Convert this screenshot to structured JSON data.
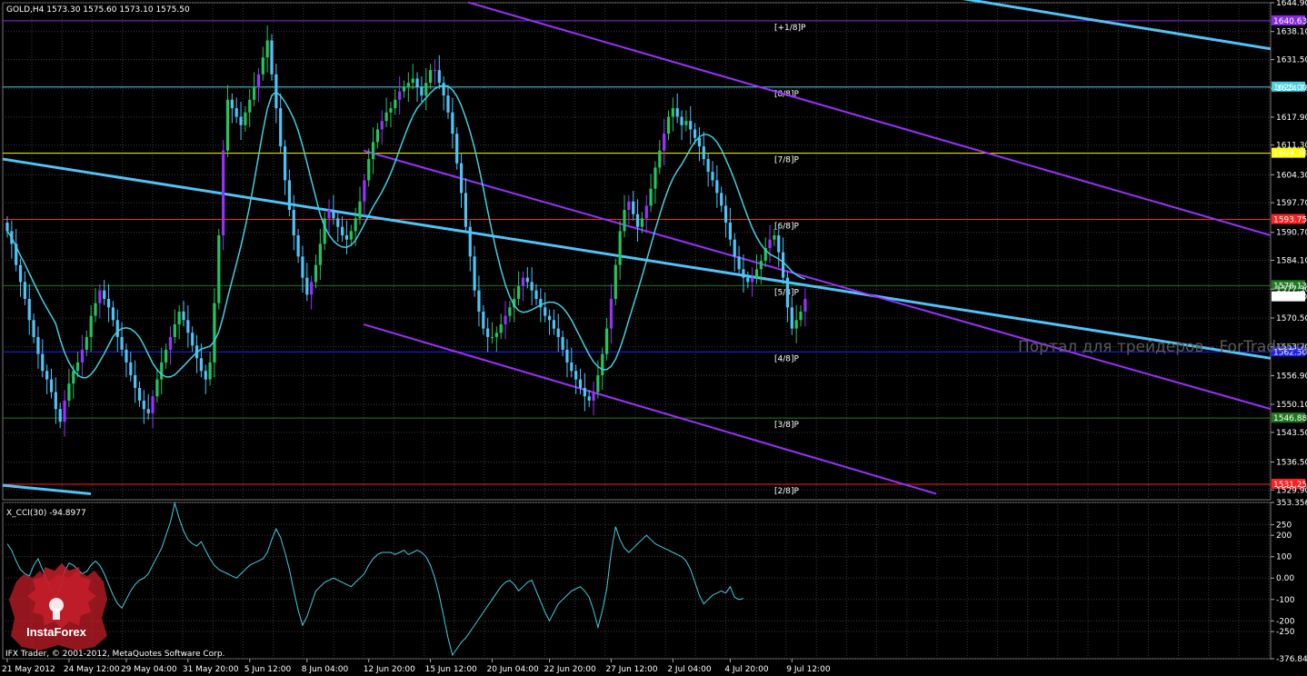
{
  "header": {
    "symbol_title": "GOLD,H4 1573.30 1575.60 1573.10 1575.50"
  },
  "indicator": {
    "title": "X_CCI(30) -94.8977"
  },
  "watermark": {
    "site": "Портал для трейдеров - ForTrader.ru",
    "brand": "InstaForex",
    "copyright": "IFX Trader, © 2001-2012, MetaQuotes Software Corp."
  },
  "colors": {
    "background": "#000000",
    "grid": "#3a3a3a",
    "bull_candle": "#22c55e",
    "bear_candle": "#4fc3f7",
    "purple_candle": "#9b30ff",
    "ma_line": "#40d0e0",
    "trend_line": "#4fc3f7",
    "channel_line": "#9b30ff",
    "cci_line": "#40d0e0"
  },
  "chart_data": [
    {
      "type": "candlestick",
      "title": "GOLD,H4",
      "ylim": [
        1527.6,
        1644.9
      ],
      "y_ticks": [
        1644.9,
        1638.1,
        1631.5,
        1624.7,
        1617.9,
        1611.3,
        1604.3,
        1597.7,
        1590.7,
        1584.1,
        1577.3,
        1570.5,
        1563.7,
        1556.9,
        1550.1,
        1543.5,
        1536.5,
        1529.9
      ],
      "x_labels": [
        "21 May 2012",
        "24 May 12:00",
        "29 May 04:00",
        "31 May 20:00",
        "5 Jun 12:00",
        "8 Jun 04:00",
        "12 Jun 20:00",
        "15 Jun 12:00",
        "20 Jun 04:00",
        "22 Jun 20:00",
        "27 Jun 12:00",
        "2 Jul 04:00",
        "4 Jul 20:00",
        "9 Jul 12:00"
      ],
      "current_price": {
        "label": "1575.50",
        "value": 1575.5
      },
      "levels": [
        {
          "name": "[+1/8]P",
          "price_label": "1640.63",
          "value": 1640.63,
          "color": "#8a2be2"
        },
        {
          "name": "[8/8]P",
          "price_label": "1625.00",
          "value": 1625.0,
          "color": "#40d0e0"
        },
        {
          "name": "[7/8]P",
          "price_label": "1609.38",
          "value": 1609.38,
          "color": "#ffff00"
        },
        {
          "name": "[6/8]P",
          "price_label": "1593.75",
          "value": 1593.75,
          "color": "#ff2020"
        },
        {
          "name": "[5/8]P",
          "price_label": "1578.13",
          "value": 1578.13,
          "color": "#1f7a1f"
        },
        {
          "name": "[4/8]P",
          "price_label": "1562.50",
          "value": 1562.5,
          "color": "#2020ff"
        },
        {
          "name": "[3/8]P",
          "price_label": "1546.88",
          "value": 1546.88,
          "color": "#1f7a1f"
        },
        {
          "name": "[2/8]P",
          "price_label": "1531.25",
          "value": 1531.25,
          "color": "#ff2020"
        }
      ],
      "close": [
        1591,
        1588,
        1583,
        1579,
        1575,
        1570,
        1566,
        1562,
        1558,
        1556,
        1553,
        1549,
        1546,
        1551,
        1555,
        1558,
        1560,
        1563,
        1566,
        1571,
        1574,
        1577,
        1575,
        1573,
        1570,
        1566,
        1563,
        1560,
        1557,
        1554,
        1551,
        1549,
        1548,
        1552,
        1556,
        1560,
        1563,
        1566,
        1569,
        1572,
        1570,
        1567,
        1564,
        1561,
        1558,
        1556,
        1560,
        1574,
        1590,
        1610,
        1622,
        1620,
        1618,
        1616,
        1619,
        1622,
        1625,
        1628,
        1632,
        1636,
        1628,
        1620,
        1611,
        1603,
        1596,
        1590,
        1585,
        1580,
        1576,
        1579,
        1583,
        1588,
        1594,
        1596,
        1594,
        1592,
        1590,
        1589,
        1591,
        1594,
        1598,
        1603,
        1608,
        1612,
        1615,
        1617,
        1619,
        1620,
        1622,
        1624,
        1625,
        1626,
        1627,
        1625,
        1623,
        1626,
        1629,
        1629,
        1626,
        1623,
        1619,
        1614,
        1607,
        1600,
        1592,
        1585,
        1577,
        1572,
        1568,
        1566,
        1566,
        1567,
        1569,
        1571,
        1573,
        1575,
        1578,
        1580,
        1579,
        1577,
        1575,
        1573,
        1571,
        1570,
        1568,
        1566,
        1563,
        1560,
        1558,
        1556,
        1554,
        1552,
        1551,
        1553,
        1557,
        1562,
        1568,
        1575,
        1583,
        1591,
        1596,
        1598,
        1595,
        1592,
        1594,
        1597,
        1601,
        1606,
        1610,
        1614,
        1618,
        1620,
        1618,
        1616,
        1617,
        1615,
        1613,
        1611,
        1608,
        1605,
        1603,
        1600,
        1597,
        1593,
        1589,
        1585,
        1582,
        1580,
        1579,
        1580,
        1582,
        1584,
        1587,
        1589,
        1590,
        1586,
        1580,
        1573,
        1568,
        1570,
        1572,
        1575
      ]
    },
    {
      "type": "line",
      "title": "X_CCI(30)",
      "ylim": [
        -376.8477,
        353.3564
      ],
      "y_ticks": [
        353.3564,
        250,
        200,
        100,
        0.0,
        -100,
        -200,
        -250,
        -376.8477
      ],
      "y_tick_labels": [
        "353.356",
        "250",
        "200",
        "100",
        "0.00",
        "-100",
        "-200",
        "-250",
        "-376.847"
      ],
      "values": [
        160,
        130,
        80,
        40,
        20,
        10,
        60,
        90,
        40,
        -10,
        -60,
        -90,
        -40,
        30,
        70,
        60,
        40,
        20,
        30,
        60,
        80,
        60,
        20,
        -30,
        -80,
        -120,
        -140,
        -100,
        -60,
        -30,
        -10,
        0,
        20,
        60,
        100,
        140,
        200,
        260,
        350,
        280,
        220,
        180,
        160,
        150,
        170,
        130,
        90,
        60,
        40,
        30,
        20,
        10,
        0,
        20,
        40,
        60,
        70,
        80,
        90,
        120,
        180,
        230,
        190,
        120,
        40,
        -60,
        -150,
        -220,
        -180,
        -120,
        -60,
        -40,
        -20,
        -10,
        0,
        -10,
        -20,
        -30,
        -40,
        -20,
        0,
        20,
        60,
        90,
        110,
        120,
        120,
        120,
        110,
        120,
        130,
        110,
        120,
        130,
        120,
        100,
        60,
        0,
        -80,
        -180,
        -280,
        -360,
        -330,
        -300,
        -280,
        -250,
        -220,
        -190,
        -160,
        -130,
        -100,
        -70,
        -40,
        -20,
        -10,
        -30,
        -60,
        -40,
        -20,
        -10,
        -60,
        -110,
        -160,
        -200,
        -160,
        -120,
        -100,
        -80,
        -60,
        -50,
        -40,
        -60,
        -90,
        -150,
        -230,
        -150,
        -50,
        120,
        240,
        180,
        140,
        120,
        140,
        160,
        180,
        200,
        180,
        160,
        150,
        140,
        130,
        120,
        110,
        100,
        80,
        40,
        -20,
        -80,
        -120,
        -100,
        -80,
        -70,
        -60,
        -70,
        -40,
        -90,
        -100,
        -95
      ]
    }
  ]
}
